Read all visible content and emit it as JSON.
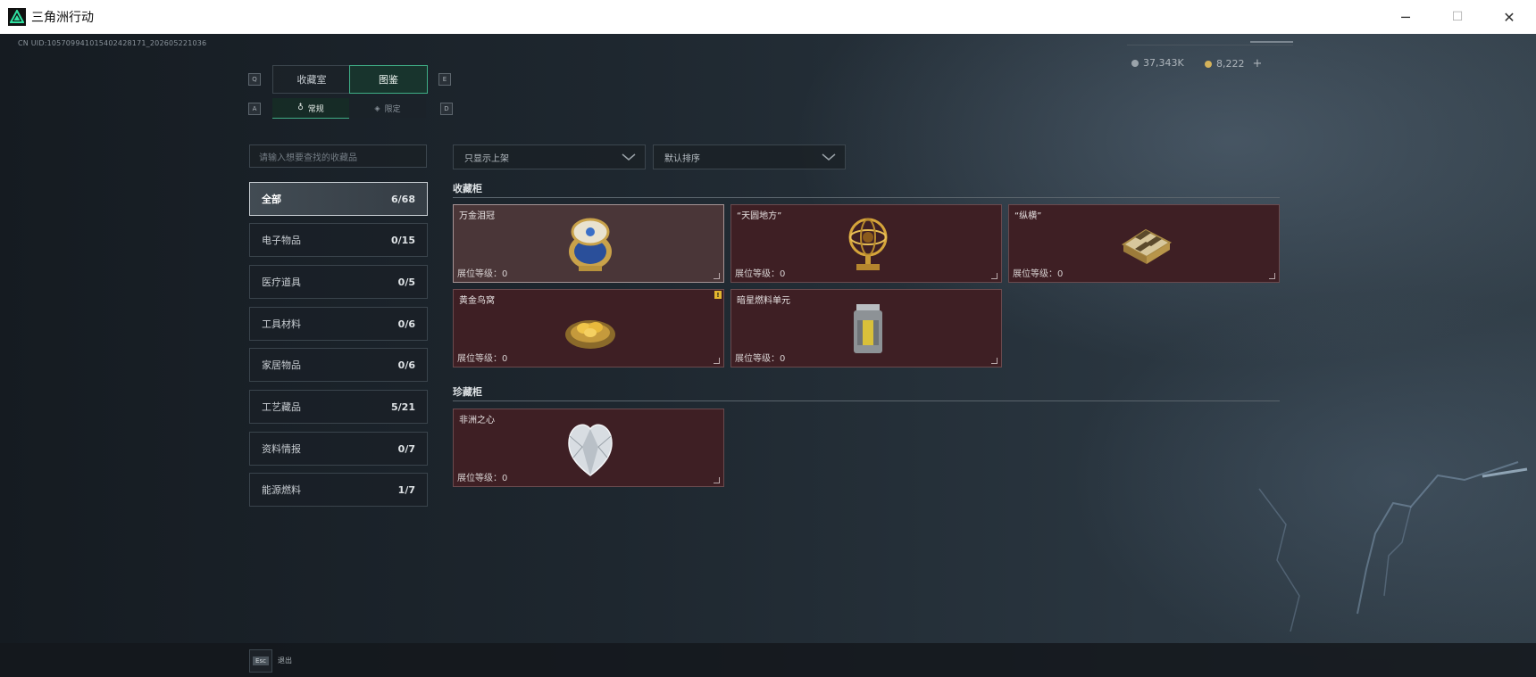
{
  "window": {
    "title": "三角洲行动",
    "minimize_label": "─",
    "maximize_label": "☐",
    "close_label": "✕"
  },
  "header": {
    "uid": "CN UID:10570994101540242817​1_202605221036",
    "currency": [
      {
        "icon": "silver-coin-icon",
        "value": "37,343K",
        "color": "#9aa3aa"
      },
      {
        "icon": "gold-coin-icon",
        "value": "8,222",
        "color": "#d4b25a",
        "plus": "+"
      }
    ]
  },
  "tabs": {
    "left_key": "Q",
    "right_key": "E",
    "items": [
      {
        "label": "收藏室",
        "active": false
      },
      {
        "label": "图鉴",
        "active": true
      }
    ]
  },
  "subtabs": {
    "left_key": "A",
    "right_key": "D",
    "items": [
      {
        "label": "常规",
        "icon": "flask-icon",
        "active": true
      },
      {
        "label": "限定",
        "icon": "gem-icon",
        "active": false
      }
    ]
  },
  "search": {
    "placeholder": "请输入想要查找的收藏品"
  },
  "categories": [
    {
      "label": "全部",
      "count": "6/68",
      "active": true
    },
    {
      "label": "电子物品",
      "count": "0/15",
      "active": false
    },
    {
      "label": "医疗道具",
      "count": "0/5",
      "active": false
    },
    {
      "label": "工具材料",
      "count": "0/6",
      "active": false
    },
    {
      "label": "家居物品",
      "count": "0/6",
      "active": false
    },
    {
      "label": "工艺藏品",
      "count": "5/21",
      "active": false
    },
    {
      "label": "资料情报",
      "count": "0/7",
      "active": false
    },
    {
      "label": "能源燃料",
      "count": "1/7",
      "active": false
    }
  ],
  "filters": {
    "shelf": "只显示上架",
    "sort": "默认排序"
  },
  "sections": [
    {
      "title": "收藏柜",
      "items": [
        {
          "name": "万金泪冠",
          "level": "展位等级：0",
          "art": "jeweled-egg-icon",
          "highlight": true
        },
        {
          "name": "“天圆地方”",
          "level": "展位等级：0",
          "art": "golden-armillary-sphere-icon"
        },
        {
          "name": "“纵横”",
          "level": "展位等级：0",
          "art": "chessboard-box-icon"
        },
        {
          "name": "黄金鸟窝",
          "level": "展位等级：0",
          "art": "golden-nest-icon",
          "badge": "!"
        },
        {
          "name": "暗星燃料单元",
          "level": "展位等级：0",
          "art": "fuel-cell-canister-icon"
        }
      ]
    },
    {
      "title": "珍藏柜",
      "items": [
        {
          "name": "非洲之心",
          "level": "展位等级：0",
          "art": "diamond-icon"
        }
      ]
    }
  ],
  "bottom": {
    "esc_key": "Esc",
    "esc_label": "退出"
  }
}
